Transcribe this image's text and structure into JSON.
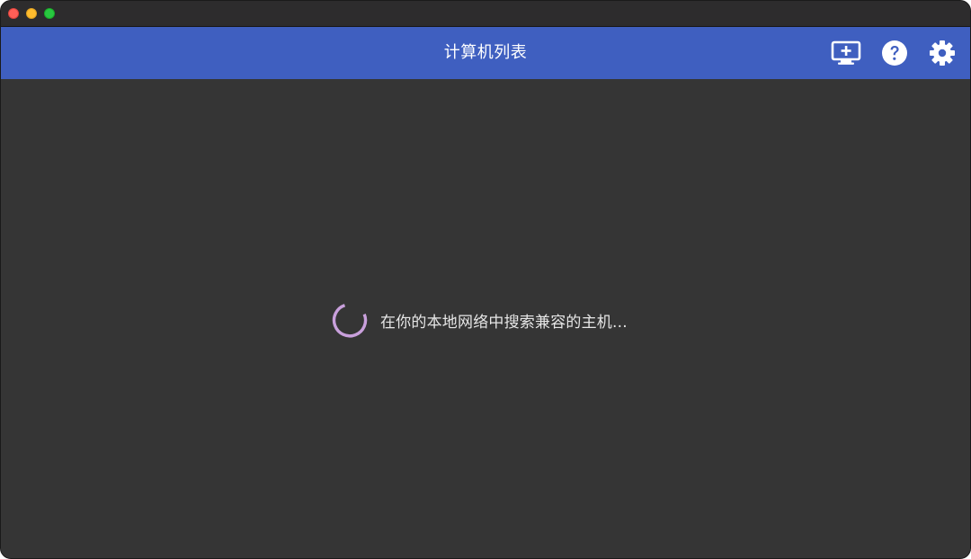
{
  "window": {
    "traffic_lights": [
      "close",
      "minimize",
      "zoom"
    ]
  },
  "appbar": {
    "title": "计算机列表",
    "actions": [
      {
        "icon": "add-pc-icon"
      },
      {
        "icon": "help-icon"
      },
      {
        "icon": "settings-icon"
      }
    ],
    "color": "#3f5fc0"
  },
  "main": {
    "loading_text": "在你的本地网络中搜索兼容的主机...",
    "spinner_color": "#c9a0dc",
    "background": "#353535"
  }
}
